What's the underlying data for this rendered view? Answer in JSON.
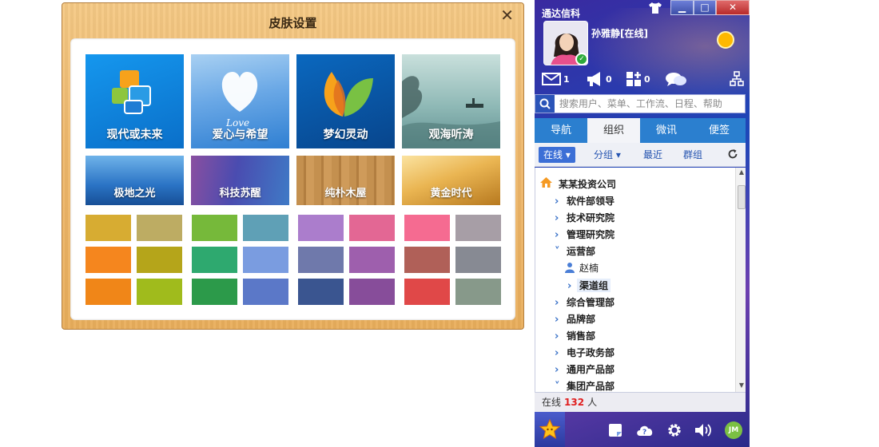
{
  "skin_dialog": {
    "title": "皮肤设置",
    "close_label": "✕",
    "themes": [
      {
        "label": "现代或未来",
        "colors": [
          "#0d8ae8",
          "#0a6fc9"
        ]
      },
      {
        "label": "爱心与希望",
        "colors": [
          "#7fb6ea",
          "#3f88d6"
        ]
      },
      {
        "label": "梦幻灵动",
        "colors": [
          "#0a63b8",
          "#084a90"
        ]
      },
      {
        "label": "观海听涛",
        "colors": [
          "#a6c9c5",
          "#6f9d9c"
        ]
      },
      {
        "label": "极地之光",
        "colors": [
          "#5da4e0",
          "#1d5fae"
        ]
      },
      {
        "label": "科技苏醒",
        "colors": [
          "#6b4ca0",
          "#3a62b8"
        ]
      },
      {
        "label": "纯朴木屋",
        "colors": [
          "#c99556",
          "#a46f33"
        ]
      },
      {
        "label": "黄金时代",
        "colors": [
          "#f2c66a",
          "#c68a26"
        ]
      }
    ],
    "swatches": [
      [
        "#d7ac32",
        "#bdac63",
        "#76b93a",
        "#5fa0b6",
        "#ab7dcc",
        "#e36794",
        "#f56b91",
        "#a79ea6"
      ],
      [
        "#f5861e",
        "#b5a51a",
        "#2ea96f",
        "#7a9ce0",
        "#6f79ab",
        "#9e5fad",
        "#b06058",
        "#878a93"
      ],
      [
        "#f08618",
        "#a0bb1c",
        "#2c9a4a",
        "#5b78c8",
        "#3a5590",
        "#874d9a",
        "#e04848",
        "#87998a"
      ]
    ]
  },
  "im": {
    "app_title": "通达信科",
    "window_buttons": {
      "minimize": "▁",
      "maximize": "□",
      "close": "✕"
    },
    "user": {
      "name": "孙雅静[在线]"
    },
    "quick_icons": [
      {
        "icon": "mail-icon",
        "count": "1"
      },
      {
        "icon": "broadcast-icon",
        "count": "0"
      },
      {
        "icon": "apps-add-icon",
        "count": "0"
      },
      {
        "icon": "chat-bubble-icon",
        "count": ""
      }
    ],
    "search": {
      "placeholder": "搜索用户、菜单、工作流、日程、帮助"
    },
    "tabs": [
      "导航",
      "组织",
      "微讯",
      "便签"
    ],
    "active_tab": 1,
    "filters": {
      "online": "在线",
      "group": "分组",
      "recent": "最近",
      "groups": "群组"
    },
    "tree": {
      "root": "某某投资公司",
      "items": [
        {
          "label": "软件部领导",
          "level": 1,
          "expanded": false
        },
        {
          "label": "技术研究院",
          "level": 1,
          "expanded": false
        },
        {
          "label": "管理研究院",
          "level": 1,
          "expanded": false
        },
        {
          "label": "运营部",
          "level": 1,
          "expanded": true
        },
        {
          "label": "赵楠",
          "level": 2,
          "type": "user"
        },
        {
          "label": "渠道组",
          "level": 2,
          "expanded": false,
          "selected": true
        },
        {
          "label": "综合管理部",
          "level": 1,
          "expanded": false
        },
        {
          "label": "品牌部",
          "level": 1,
          "expanded": false
        },
        {
          "label": "销售部",
          "level": 1,
          "expanded": false
        },
        {
          "label": "电子政务部",
          "level": 1,
          "expanded": false
        },
        {
          "label": "通用产品部",
          "level": 1,
          "expanded": false
        },
        {
          "label": "集团产品部",
          "level": 1,
          "expanded": true
        }
      ]
    },
    "status": {
      "prefix": "在线",
      "count": "132",
      "suffix": "人"
    },
    "bottom_icons": [
      "star-icon",
      "note-icon",
      "help-cloud-icon",
      "gear-icon",
      "volume-icon",
      "jm-icon"
    ],
    "bottom_jm_label": "JM"
  }
}
